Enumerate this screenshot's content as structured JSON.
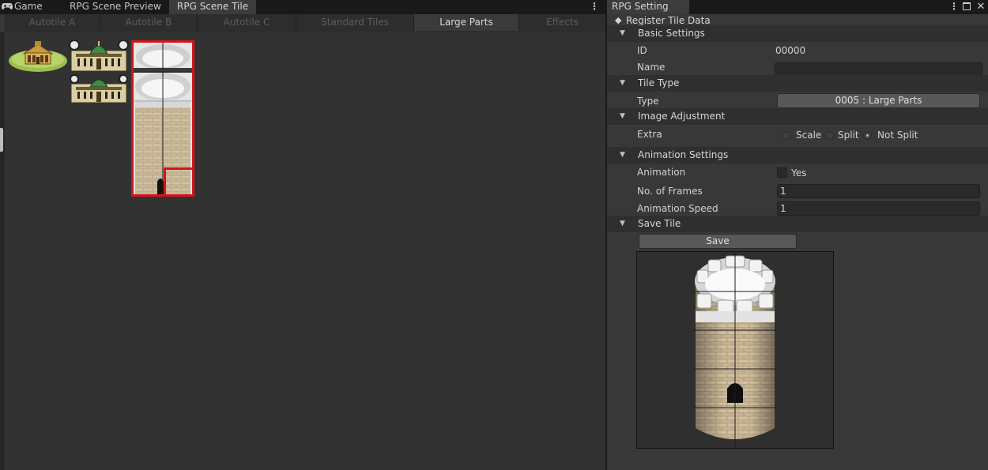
{
  "left_window": {
    "tabs": [
      {
        "label": "Game",
        "icon": "gamepad-icon"
      },
      {
        "label": "RPG Scene Preview"
      },
      {
        "label": "RPG Scene Tile"
      }
    ],
    "menu_glyph": "⋮",
    "sub_tabs": [
      "Autotile A",
      "Autotile B",
      "Autotile C",
      "Standard Tiles",
      "Large Parts",
      "Effects"
    ],
    "active_sub_tab": "Large Parts"
  },
  "right_window": {
    "tab_label": "RPG Setting",
    "menu_glyph": "⋮",
    "close_glyph": "✕",
    "section_title": "Register Tile Data",
    "basic_settings": {
      "title": "Basic Settings",
      "id_label": "ID",
      "id_value": "00000",
      "name_label": "Name",
      "name_value": ""
    },
    "tile_type": {
      "title": "Tile Type",
      "type_label": "Type",
      "type_value": "0005 : Large Parts"
    },
    "image_adjustment": {
      "title": "Image Adjustment",
      "extra_label": "Extra",
      "options": [
        "Scale",
        "Split",
        "Not Split"
      ],
      "selected": "Not Split"
    },
    "animation_settings": {
      "title": "Animation Settings",
      "animation_label": "Animation",
      "animation_checkbox_label": "Yes",
      "animation_enabled": false,
      "frames_label": "No. of Frames",
      "frames_value": "1",
      "speed_label": "Animation Speed",
      "speed_value": "1"
    },
    "save_tile": {
      "title": "Save Tile",
      "save_label": "Save"
    }
  },
  "colors": {
    "selection_border": "#d5141a",
    "panel_bg": "#383838",
    "tab_bar_bg": "#191919"
  }
}
